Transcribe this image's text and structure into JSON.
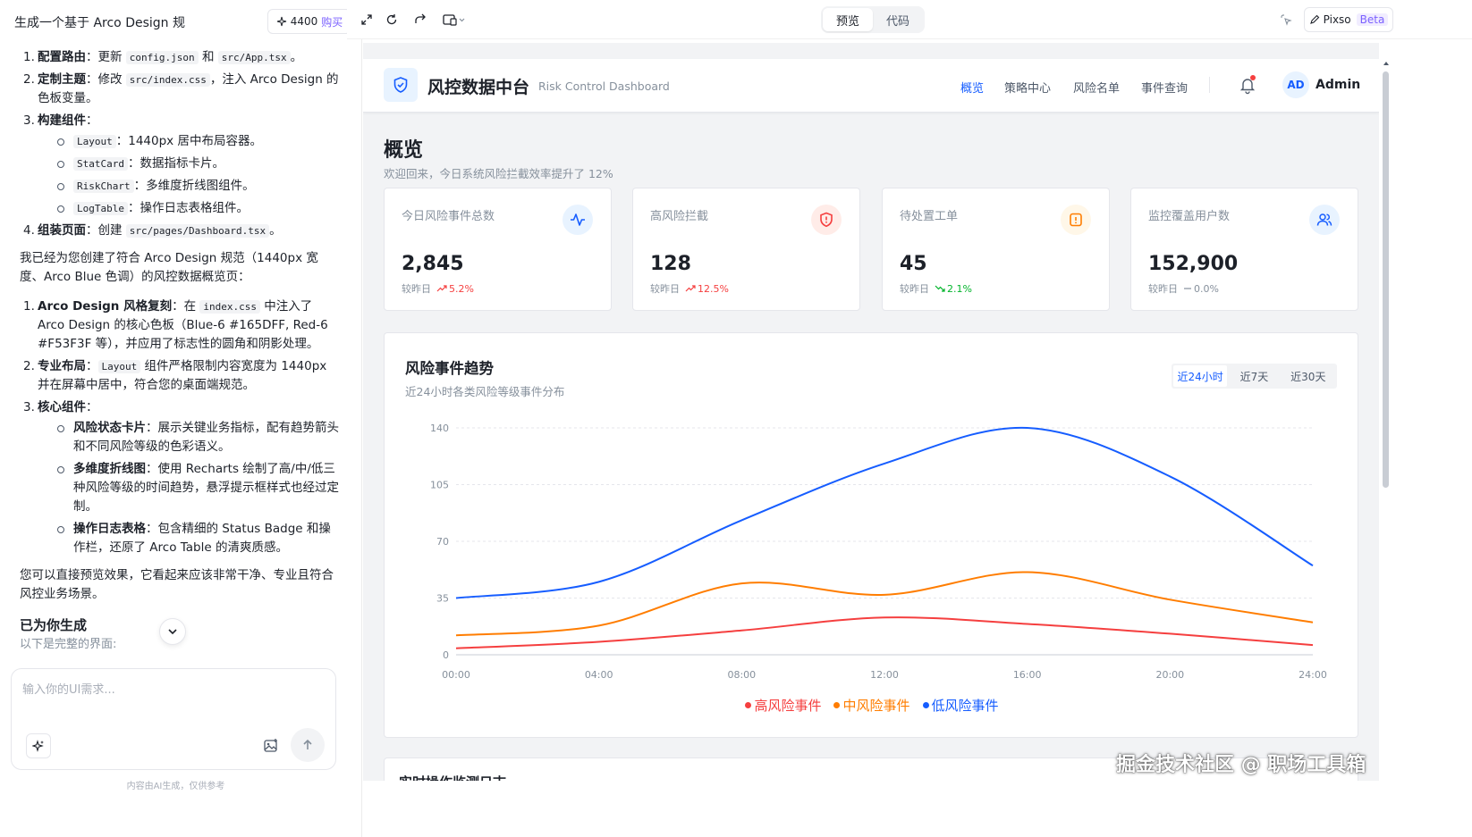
{
  "left": {
    "title": "生成一个基于 Arco Design 规",
    "credits": "4400",
    "buy_label": "购买",
    "plan": [
      {
        "num": "1.",
        "bold": "配置路由",
        "pre": "：更新 ",
        "c1": "config.json",
        "mid": " 和 ",
        "c2": "src/App.tsx",
        "post": "。"
      },
      {
        "num": "2.",
        "bold": "定制主题",
        "pre": "：修改 ",
        "c1": "src/index.css",
        "mid": "，注入 Arco Design 的色板变量。",
        "c2": "",
        "post": ""
      },
      {
        "num": "3.",
        "bold": "构建组件",
        "pre": "：",
        "c1": "",
        "mid": "",
        "c2": "",
        "post": ""
      },
      {
        "num": "4.",
        "bold": "组装页面",
        "pre": "：创建 ",
        "c1": "src/pages/Dashboard.tsx",
        "mid": "",
        "c2": "",
        "post": "。"
      }
    ],
    "components": [
      {
        "code": "Layout",
        "text": "：1440px 居中布局容器。"
      },
      {
        "code": "StatCard",
        "text": "：数据指标卡片。"
      },
      {
        "code": "RiskChart",
        "text": "：多维度折线图组件。"
      },
      {
        "code": "LogTable",
        "text": "：操作日志表格组件。"
      }
    ],
    "summary": "我已经为您创建了符合 Arco Design 规范（1440px 宽度、Arco Blue 色调）的风控数据概览页：",
    "points": [
      {
        "num": "1.",
        "bold": "Arco Design 风格复刻",
        "pre": "：在 ",
        "code": "index.css",
        "post": " 中注入了 Arco Design 的核心色板（Blue-6 #165DFF, Red-6 #F53F3F 等），并应用了标志性的圆角和阴影处理。"
      },
      {
        "num": "2.",
        "bold": "专业布局",
        "pre": "：",
        "code": "Layout",
        "post": " 组件严格限制内容宽度为 1440px 并在屏幕中居中，符合您的桌面端规范。"
      },
      {
        "num": "3.",
        "bold": "核心组件",
        "pre": "：",
        "code": "",
        "post": ""
      }
    ],
    "core": [
      {
        "bold": "风险状态卡片",
        "text": "：展示关键业务指标，配有趋势箭头和不同风险等级的色彩语义。"
      },
      {
        "bold": "多维度折线图",
        "text": "：使用 Recharts 绘制了高/中/低三种风险等级的时间趋势，悬浮提示框样式也经过定制。"
      },
      {
        "bold": "操作日志表格",
        "text": "：包含精细的 Status Badge 和操作栏，还原了 Arco Table 的清爽质感。"
      }
    ],
    "closing": "您可以直接预览效果，它看起来应该非常干净、专业且符合风控业务场景。",
    "generated_title": "已为你生成",
    "generated_sub": "以下是完整的界面:",
    "input_placeholder": "输入你的UI需求...",
    "disclaimer": "内容由AI生成，仅供参考"
  },
  "topbar": {
    "preview_label": "预览",
    "code_label": "代码",
    "pixso_label": "Pixso",
    "beta_label": "Beta"
  },
  "dashboard": {
    "brand": "风控数据中台",
    "brand_sub": "Risk Control Dashboard",
    "nav": [
      "概览",
      "策略中心",
      "风险名单",
      "事件查询"
    ],
    "avatar": "AD",
    "user": "Admin",
    "page_title": "概览",
    "page_sub": "欢迎回来，今日系统风险拦截效率提升了 12%",
    "compare_label": "较昨日",
    "stats": [
      {
        "label": "今日风险事件总数",
        "value": "2,845",
        "change": "5.2%",
        "trend": "up",
        "color": "#f53f3f",
        "icon": "activity-icon",
        "icon_bg": "#e8f3ff",
        "icon_color": "#165dff"
      },
      {
        "label": "高风险拦截",
        "value": "128",
        "change": "12.5%",
        "trend": "up",
        "color": "#f53f3f",
        "icon": "shield-alert-icon",
        "icon_bg": "#ffece8",
        "icon_color": "#f53f3f"
      },
      {
        "label": "待处置工单",
        "value": "45",
        "change": "2.1%",
        "trend": "down",
        "color": "#00b42a",
        "icon": "alert-square-icon",
        "icon_bg": "#fff7e8",
        "icon_color": "#ff7d00"
      },
      {
        "label": "监控覆盖用户数",
        "value": "152,900",
        "change": "0.0%",
        "trend": "flat",
        "color": "#86909c",
        "icon": "users-icon",
        "icon_bg": "#e8f3ff",
        "icon_color": "#165dff"
      }
    ],
    "chart_title": "风险事件趋势",
    "chart_sub": "近24小时各类风险等级事件分布",
    "ranges": [
      "近24小时",
      "近7天",
      "近30天"
    ],
    "active_range": 0,
    "log_title": "实时操作监测日志"
  },
  "chart_data": {
    "type": "line",
    "x": [
      "00:00",
      "04:00",
      "08:00",
      "12:00",
      "16:00",
      "20:00",
      "24:00"
    ],
    "ylim": [
      0,
      140
    ],
    "yticks": [
      0,
      35,
      70,
      105,
      140
    ],
    "series": [
      {
        "name": "高风险事件",
        "color": "#f53f3f",
        "values": [
          4,
          8,
          15,
          23,
          19,
          13,
          6
        ]
      },
      {
        "name": "中风险事件",
        "color": "#ff7d00",
        "values": [
          12,
          18,
          44,
          37,
          51,
          34,
          20
        ]
      },
      {
        "name": "低风险事件",
        "color": "#165dff",
        "values": [
          35,
          45,
          83,
          118,
          140,
          110,
          55
        ]
      }
    ],
    "grid": true,
    "legend": "bottom-center"
  },
  "watermark": "掘金技术社区 @ 职场工具箱"
}
